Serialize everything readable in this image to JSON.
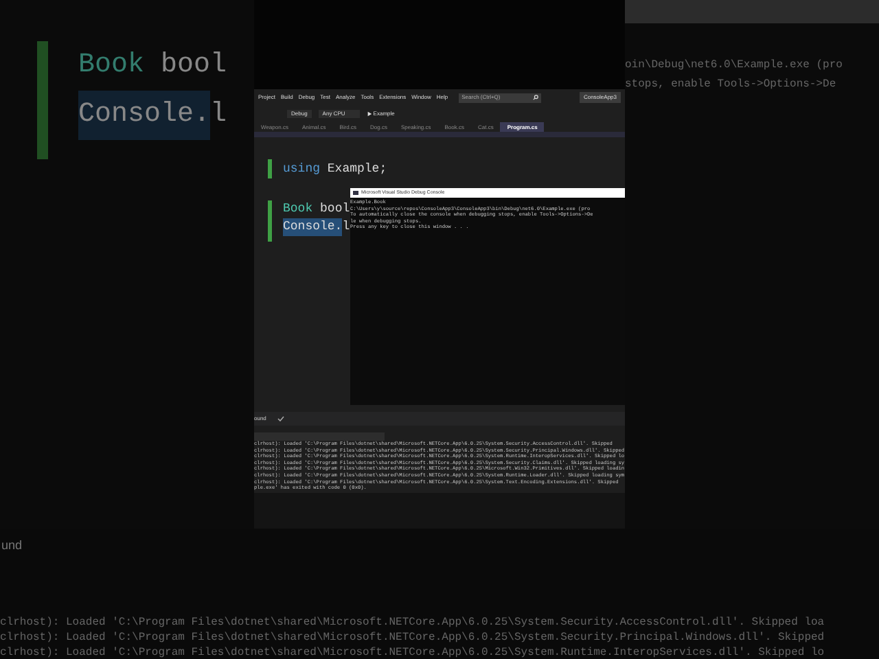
{
  "backdrop_left": {
    "code_lines": [
      [
        {
          "text": "Book ",
          "kind": "type",
          "selected": false
        },
        {
          "text": "bool",
          "kind": "plain",
          "selected": false
        }
      ],
      [
        {
          "text": "Console.",
          "kind": "plain",
          "selected": true
        },
        {
          "text": "l",
          "kind": "plain",
          "selected": false
        }
      ]
    ]
  },
  "backdrop_right": {
    "console_lines": [
      "oin\\Debug\\net6.0\\Example.exe (pro",
      "stops, enable Tools->Options->De"
    ]
  },
  "menu_bar": {
    "items": [
      "Project",
      "Build",
      "Debug",
      "Test",
      "Analyze",
      "Tools",
      "Extensions",
      "Window",
      "Help"
    ],
    "search": {
      "placeholder": "Search (Ctrl+Q)"
    },
    "solution": "ConsoleApp3"
  },
  "toolbar": {
    "configuration": "Debug",
    "platform": "Any CPU",
    "start": "Example"
  },
  "tabs": [
    {
      "label": "Weapon.cs",
      "selected": false
    },
    {
      "label": "Animal.cs",
      "selected": false
    },
    {
      "label": "Bird.cs",
      "selected": false
    },
    {
      "label": "Dog.cs",
      "selected": false
    },
    {
      "label": "Speaking.cs",
      "selected": false
    },
    {
      "label": "Book.cs",
      "selected": false
    },
    {
      "label": "Cat.cs",
      "selected": false
    },
    {
      "label": "Program.cs",
      "selected": true
    }
  ],
  "editor": {
    "lines": [
      [
        {
          "text": "using ",
          "kind": "keyword",
          "selected": false
        },
        {
          "text": "Example;",
          "kind": "plain",
          "selected": false
        }
      ],
      [
        {
          "text": "Book ",
          "kind": "type",
          "selected": false
        },
        {
          "text": "bool",
          "kind": "plain",
          "selected": false
        }
      ],
      [
        {
          "text": "Console.",
          "kind": "plain",
          "selected": true
        },
        {
          "text": "l",
          "kind": "plain",
          "selected": false
        }
      ]
    ]
  },
  "debug_console": {
    "title": "Microsoft Visual Studio Debug Console",
    "lines": [
      "Example.Book",
      "C:\\Users\\y\\source\\repos\\ConsoleApp3\\ConsoleApp3\\bin\\Debug\\net6.0\\Example.exe (pro",
      "To automatically close the console when debugging stops, enable Tools->Options->De",
      "le when debugging stops.",
      "Press any key to close this window . . ."
    ]
  },
  "output": {
    "status_text": "ound",
    "log_lines": [
      "clrhost): Loaded 'C:\\Program Files\\dotnet\\shared\\Microsoft.NETCore.App\\6.0.25\\System.Security.AccessControl.dll'. Skipped",
      "clrhost): Loaded 'C:\\Program Files\\dotnet\\shared\\Microsoft.NETCore.App\\6.0.25\\System.Security.Principal.Windows.dll'. Skipped",
      "clrhost): Loaded 'C:\\Program Files\\dotnet\\shared\\Microsoft.NETCore.App\\6.0.25\\System.Runtime.InteropServices.dll'. Skipped lo",
      "clrhost): Loaded 'C:\\Program Files\\dotnet\\shared\\Microsoft.NETCore.App\\6.0.25\\System.Security.Claims.dll'. Skipped loading sy",
      "clrhost): Loaded 'C:\\Program Files\\dotnet\\shared\\Microsoft.NETCore.App\\6.0.25\\Microsoft.Win32.Primitives.dll'. Skipped loadin",
      "clrhost): Loaded 'C:\\Program Files\\dotnet\\shared\\Microsoft.NETCore.App\\6.0.25\\System.Runtime.Loader.dll'. Skipped loading sym",
      "clrhost): Loaded 'C:\\Program Files\\dotnet\\shared\\Microsoft.NETCore.App\\6.0.25\\System.Text.Encoding.Extensions.dll'. Skipped",
      "ple.exe' has exited with code 0 (0x0)."
    ]
  },
  "backdrop_bottom": {
    "status_text": "und",
    "log_lines": [
      "clrhost): Loaded 'C:\\Program Files\\dotnet\\shared\\Microsoft.NETCore.App\\6.0.25\\System.Security.AccessControl.dll'. Skipped loa",
      "clrhost): Loaded 'C:\\Program Files\\dotnet\\shared\\Microsoft.NETCore.App\\6.0.25\\System.Security.Principal.Windows.dll'. Skipped",
      "clrhost): Loaded 'C:\\Program Files\\dotnet\\shared\\Microsoft.NETCore.App\\6.0.25\\System.Runtime.InteropServices.dll'. Skipped lo"
    ]
  }
}
